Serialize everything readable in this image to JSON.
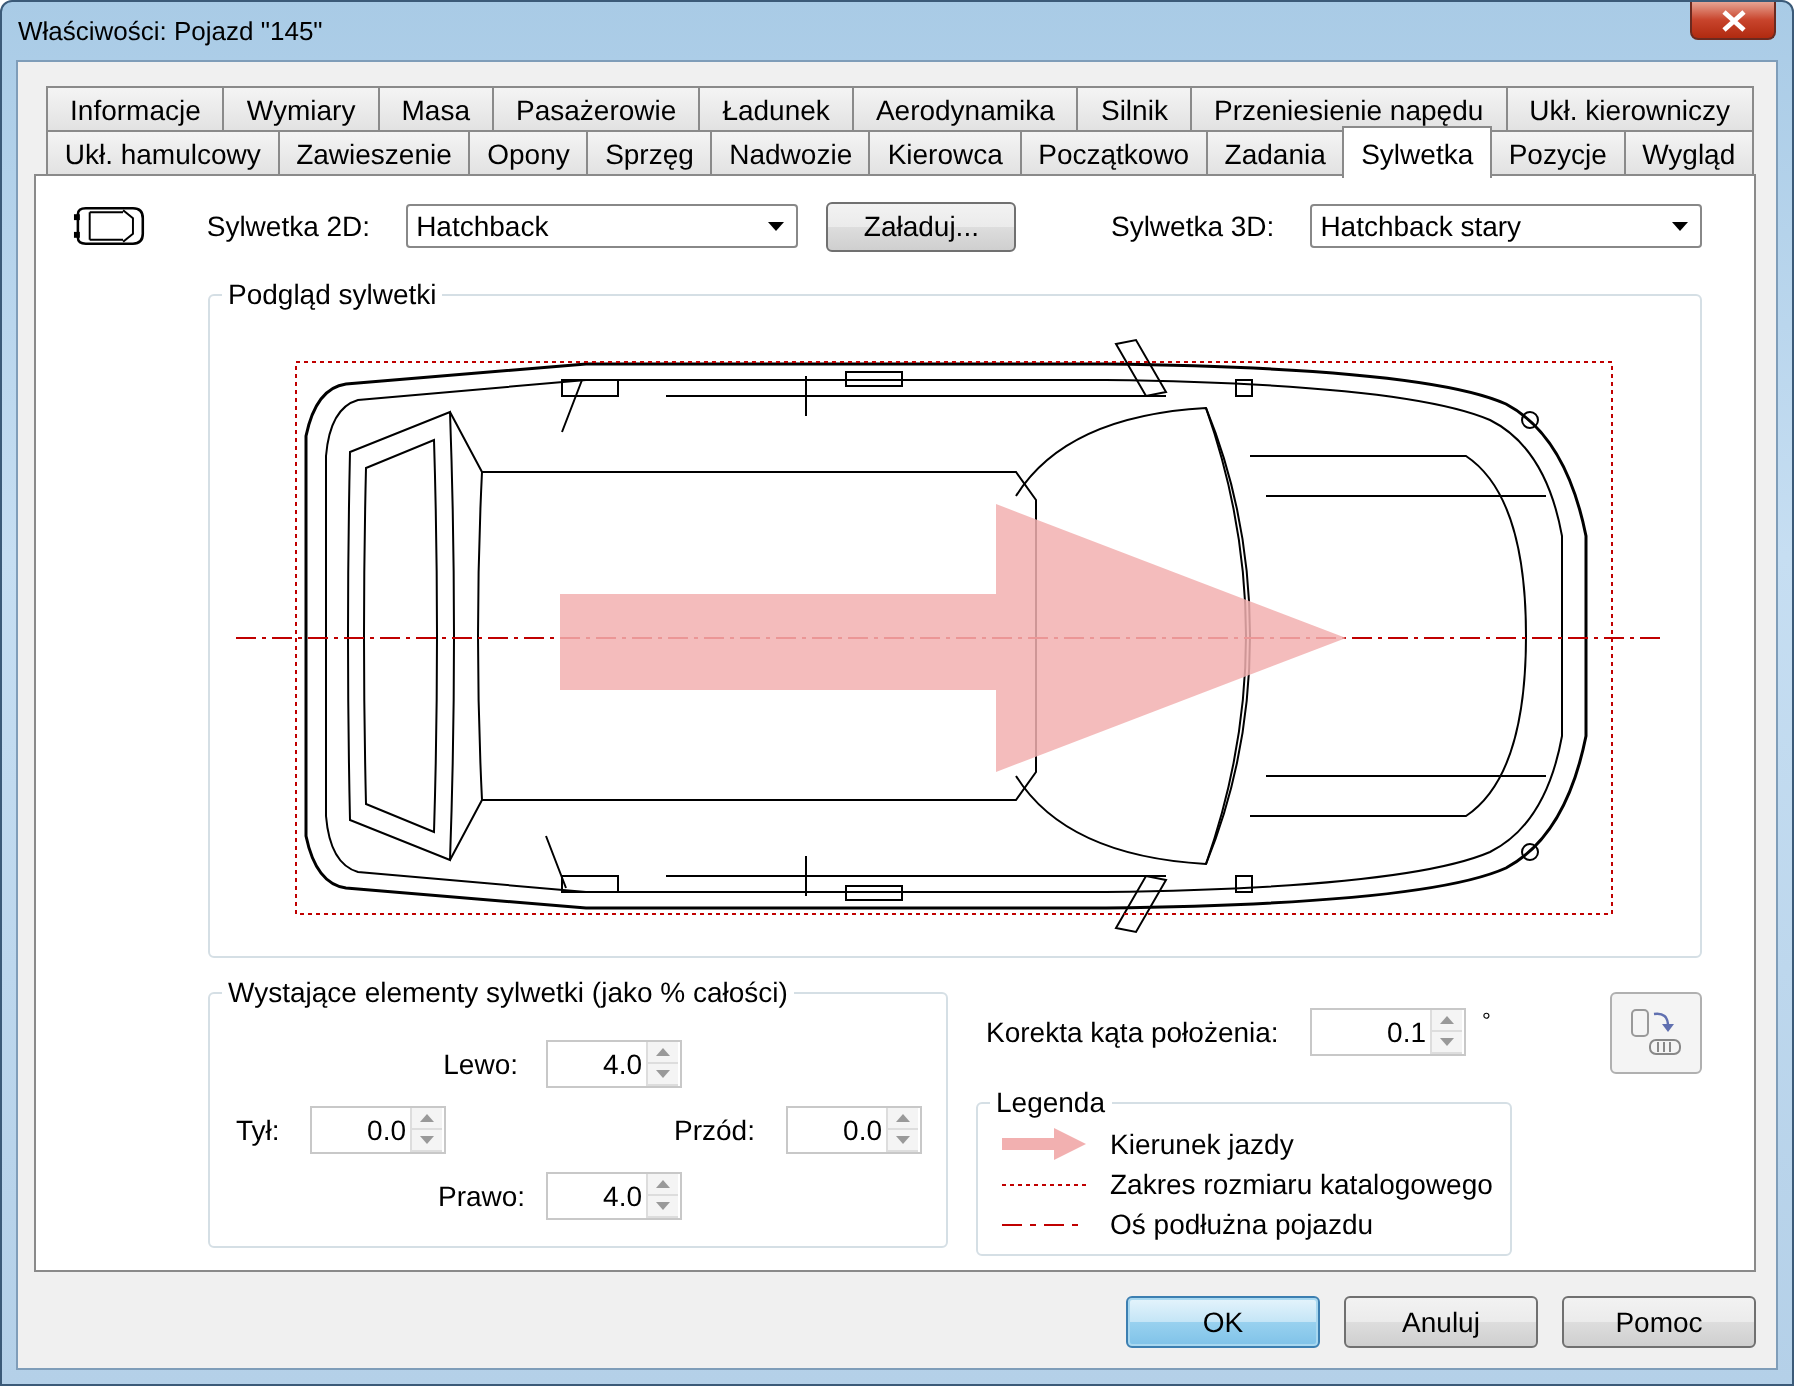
{
  "window": {
    "title": "Właściwości: Pojazd \"145\""
  },
  "tab_rows": [
    [
      {
        "label": "Informacje",
        "selected": false
      },
      {
        "label": "Wymiary",
        "selected": false
      },
      {
        "label": "Masa",
        "selected": false
      },
      {
        "label": "Pasażerowie",
        "selected": false
      },
      {
        "label": "Ładunek",
        "selected": false
      },
      {
        "label": "Aerodynamika",
        "selected": false
      },
      {
        "label": "Silnik",
        "selected": false
      },
      {
        "label": "Przeniesienie napędu",
        "selected": false
      },
      {
        "label": "Ukł. kierowniczy",
        "selected": false
      }
    ],
    [
      {
        "label": "Ukł. hamulcowy",
        "selected": false
      },
      {
        "label": "Zawieszenie",
        "selected": false
      },
      {
        "label": "Opony",
        "selected": false
      },
      {
        "label": "Sprzęg",
        "selected": false
      },
      {
        "label": "Nadwozie",
        "selected": false
      },
      {
        "label": "Kierowca",
        "selected": false
      },
      {
        "label": "Początkowo",
        "selected": false
      },
      {
        "label": "Zadania",
        "selected": false
      },
      {
        "label": "Sylwetka",
        "selected": true
      },
      {
        "label": "Pozycje",
        "selected": false
      },
      {
        "label": "Wygląd",
        "selected": false
      }
    ]
  ],
  "silhouette_2d": {
    "label": "Sylwetka 2D:",
    "value": "Hatchback"
  },
  "load_button": {
    "label": "Załaduj..."
  },
  "silhouette_3d": {
    "label": "Sylwetka 3D:",
    "value": "Hatchback stary"
  },
  "preview": {
    "title": "Podgląd sylwetki"
  },
  "protrusions": {
    "title": "Wystające elementy sylwetki (jako % całości)",
    "left": {
      "label": "Lewo:",
      "value": "4.0"
    },
    "rear": {
      "label": "Tył:",
      "value": "0.0"
    },
    "front": {
      "label": "Przód:",
      "value": "0.0"
    },
    "right": {
      "label": "Prawo:",
      "value": "4.0"
    }
  },
  "angle_correction": {
    "label": "Korekta kąta położenia:",
    "value": "0.1",
    "unit": "°"
  },
  "legend": {
    "title": "Legenda",
    "items": [
      {
        "kind": "arrow",
        "label": "Kierunek jazdy"
      },
      {
        "kind": "dotted",
        "label": "Zakres rozmiaru katalogowego"
      },
      {
        "kind": "dashdot",
        "label": "Oś podłużna pojazdu"
      }
    ]
  },
  "buttons": [
    {
      "label": "OK",
      "default": true
    },
    {
      "label": "Anuluj",
      "default": false
    },
    {
      "label": "Pomoc",
      "default": false
    }
  ]
}
